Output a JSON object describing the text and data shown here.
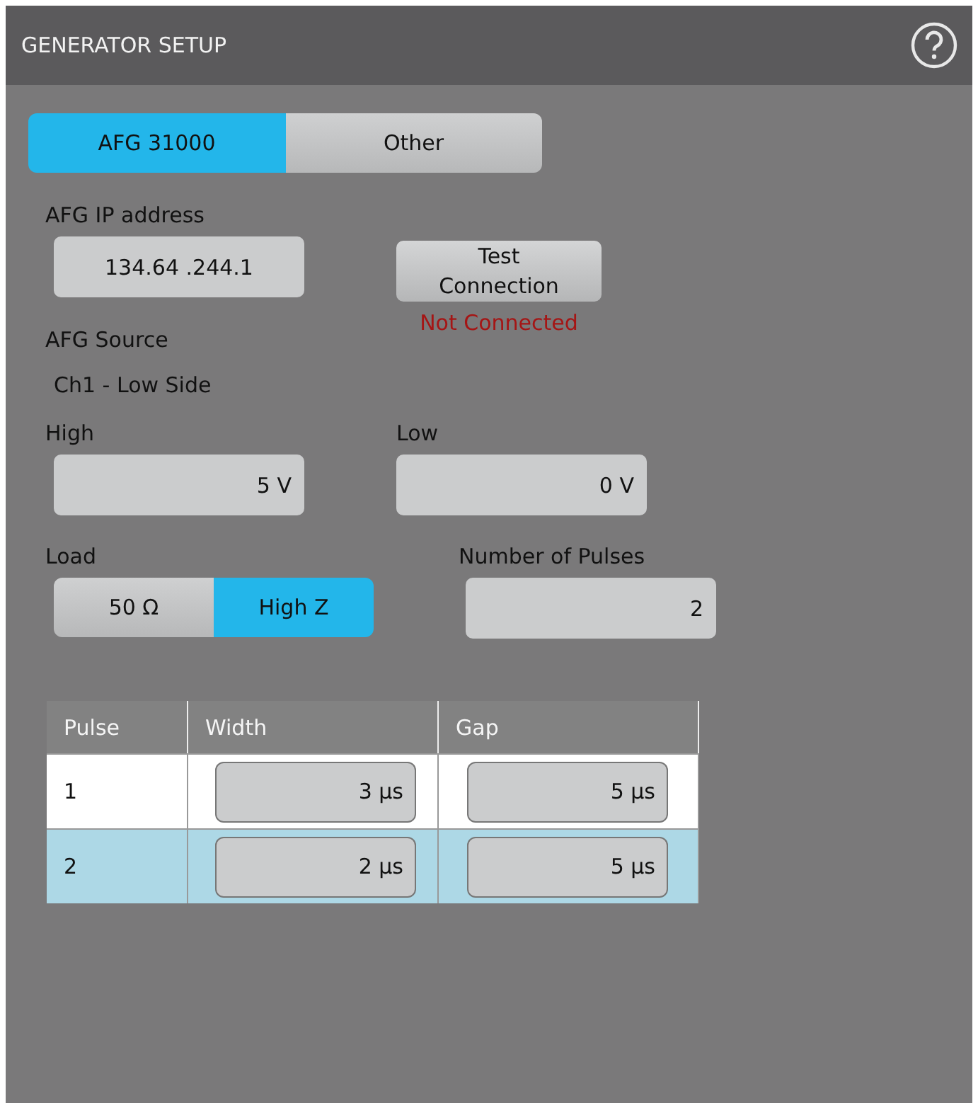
{
  "panel": {
    "title": "GENERATOR SETUP"
  },
  "generator_tabs": [
    {
      "label": "AFG 31000",
      "selected": true
    },
    {
      "label": "Other",
      "selected": false
    }
  ],
  "ip": {
    "label": "AFG IP address",
    "value": "134.64 .244.1"
  },
  "test_button": {
    "label": "Test\nConnection"
  },
  "connection_status": {
    "text": "Not Connected",
    "connected": false
  },
  "source": {
    "label": "AFG Source",
    "value": "Ch1 - Low Side"
  },
  "high": {
    "label": "High",
    "value": "5 V"
  },
  "low": {
    "label": "Low",
    "value": "0 V"
  },
  "load": {
    "label": "Load",
    "options": [
      {
        "label": "50 Ω",
        "selected": false
      },
      {
        "label": "High Z",
        "selected": true
      }
    ]
  },
  "pulses": {
    "label": "Number of Pulses",
    "value": "2"
  },
  "table": {
    "columns": [
      "Pulse",
      "Width",
      "Gap"
    ],
    "rows": [
      {
        "pulse": "1",
        "width": "3 µs",
        "gap": "5 µs",
        "selected": false
      },
      {
        "pulse": "2",
        "width": "2 µs",
        "gap": "5 µs",
        "selected": true
      }
    ]
  }
}
